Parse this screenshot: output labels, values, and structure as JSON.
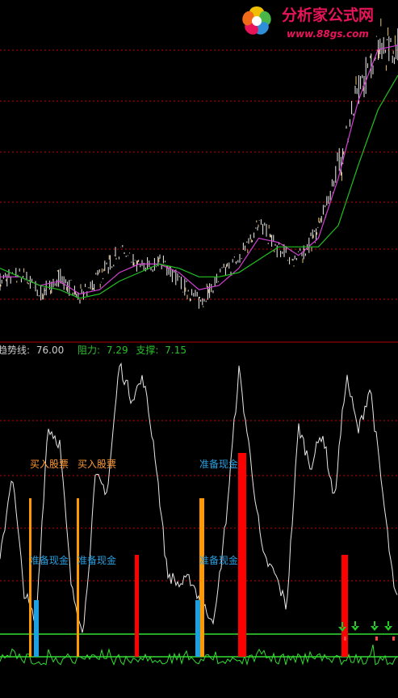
{
  "logo": {
    "title": "分析家公式网",
    "url": "www.88gs.com",
    "petal_colors": [
      "#f0c000",
      "#49b848",
      "#2e8fd8",
      "#e8145a",
      "#f06a1a"
    ]
  },
  "indicator_header": {
    "trend_label": "趋势线:",
    "trend_value": "76.00",
    "resist_label": "阻力:",
    "resist_value": "7.29",
    "support_label": "支撑:",
    "support_value": "7.15"
  },
  "colors": {
    "background": "#000000",
    "dashed_grid": "#cc0000",
    "separator": "#b00000",
    "ma_slow": "#22c022",
    "ma_fast": "#d040d0",
    "candle": "#f0f0f0",
    "oscillator": "#e8e8e8",
    "lower_green": "#33dd33",
    "buy_bar": "#ff9900",
    "cash_bar": "#1e9fe0",
    "red_bar": "#ff0000",
    "buy_text": "#ff9933",
    "cash_text": "#2a9fe0",
    "arrow": "#22cc22",
    "resist_text": "#2bbf2b",
    "support_text": "#2bbf2b",
    "trend_text": "#cccccc"
  },
  "annotations": [
    {
      "text": "买入股票",
      "color": "buy_text",
      "x": 18,
      "y": 112
    },
    {
      "text": "买入股票",
      "color": "buy_text",
      "x": 28,
      "y": 112
    },
    {
      "text": "买入股票",
      "color": "buy_text",
      "x": 73,
      "y": 112
    },
    {
      "text": "准备现金",
      "color": "cash_text",
      "x": 18,
      "y": 86
    },
    {
      "text": "准备现金",
      "color": "cash_text",
      "x": 28,
      "y": 86
    },
    {
      "text": "准备现金",
      "color": "cash_text",
      "x": 73,
      "y": 86
    }
  ],
  "chart_data": [
    {
      "type": "line",
      "panel": "price",
      "x": [
        0,
        5,
        10,
        15,
        20,
        25,
        30,
        35,
        40,
        45,
        50,
        55,
        60,
        65,
        70,
        75,
        80,
        85,
        90,
        95,
        100
      ],
      "series": [
        {
          "values": [
            5.4,
            5.6,
            5.1,
            5.5,
            5.0,
            5.5,
            6.1,
            5.7,
            5.9,
            5.4,
            4.9,
            5.5,
            5.9,
            6.8,
            6.1,
            5.9,
            6.6,
            8.1,
            9.8,
            10.9,
            10.9
          ]
        },
        {
          "values": [
            5.5,
            5.5,
            5.3,
            5.4,
            5.1,
            5.2,
            5.6,
            5.8,
            5.8,
            5.6,
            5.2,
            5.3,
            5.7,
            6.4,
            6.3,
            6.0,
            6.4,
            7.8,
            9.6,
            10.8,
            10.9
          ]
        },
        {
          "values": [
            5.7,
            5.5,
            5.3,
            5.2,
            5.0,
            5.1,
            5.4,
            5.6,
            5.8,
            5.7,
            5.5,
            5.5,
            5.6,
            5.9,
            6.2,
            6.2,
            6.2,
            6.7,
            8.1,
            9.4,
            10.2
          ]
        }
      ]
    },
    {
      "type": "line",
      "panel": "oscillator",
      "x": [
        0,
        3,
        6,
        9,
        12,
        15,
        18,
        21,
        24,
        27,
        30,
        33,
        36,
        39,
        42,
        45,
        48,
        51,
        54,
        57,
        60,
        63,
        66,
        69,
        72,
        75,
        78,
        81,
        84,
        87,
        90,
        93,
        96,
        99,
        100
      ],
      "series": [
        {
          "values": [
            30,
            62,
            20,
            8,
            78,
            72,
            20,
            6,
            60,
            55,
            100,
            88,
            95,
            68,
            26,
            22,
            24,
            14,
            10,
            48,
            98,
            66,
            32,
            26,
            14,
            78,
            64,
            76,
            52,
            96,
            76,
            92,
            56,
            20,
            16
          ]
        }
      ]
    },
    {
      "type": "bar",
      "panel": "signals",
      "categories": [
        "buy",
        "cash",
        "buy",
        "red",
        "buy",
        "cash",
        "red",
        "red"
      ],
      "values": [
        70,
        25,
        70,
        45,
        70,
        25,
        90,
        45
      ]
    }
  ]
}
